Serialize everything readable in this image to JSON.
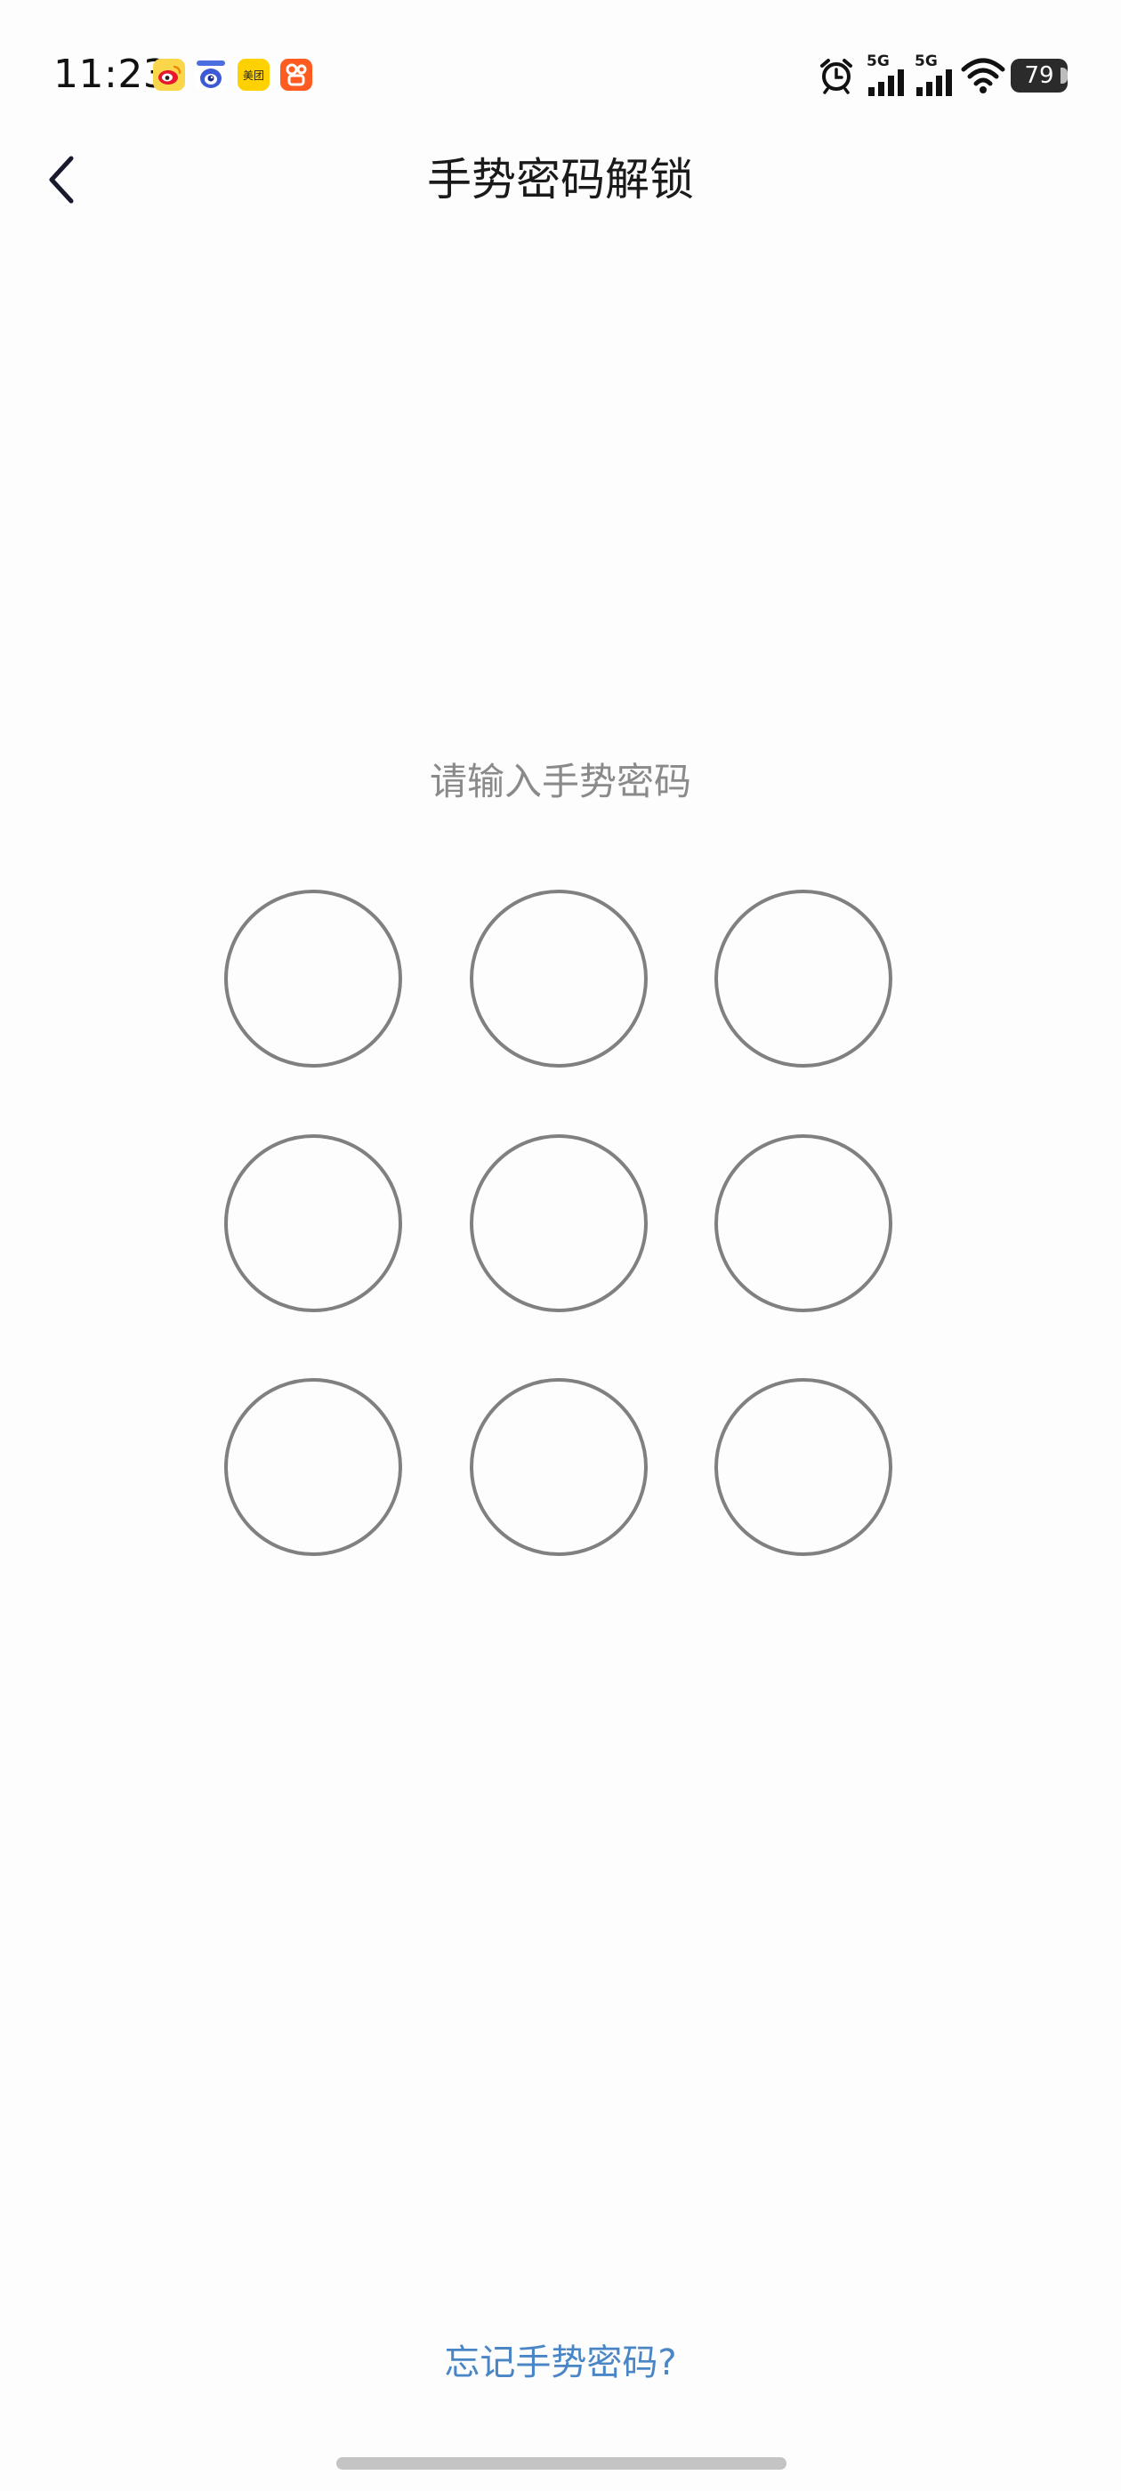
{
  "status_bar": {
    "time": "11:23",
    "notification_icons": [
      "weibo-icon",
      "qq-icon",
      "meituan-icon",
      "kuaishou-icon"
    ],
    "meituan_label": "美团",
    "network_1": "5G",
    "network_2": "5G",
    "battery_level": "79"
  },
  "header": {
    "title": "手势密码解锁",
    "back_icon": "chevron-left-icon"
  },
  "gesture": {
    "prompt": "请输入手势密码",
    "dots": 9,
    "dot_color": "#808080"
  },
  "footer": {
    "forgot_label": "忘记手势密码?",
    "link_color": "#4a86c6"
  }
}
